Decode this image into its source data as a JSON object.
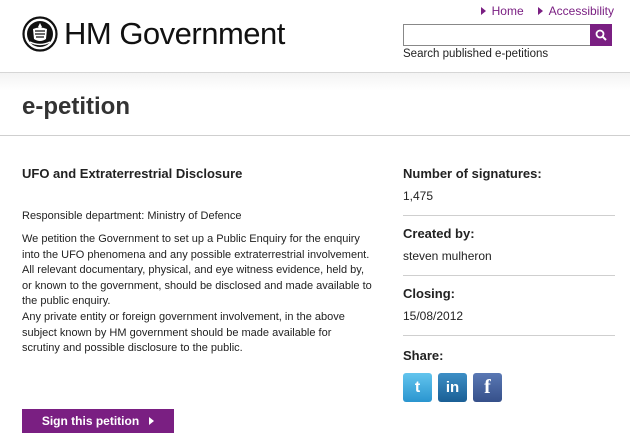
{
  "header": {
    "logo_text": "HM Government",
    "links": [
      {
        "label": "Home"
      },
      {
        "label": "Accessibility"
      }
    ],
    "search": {
      "placeholder": "",
      "value": "",
      "caption": "Search published e-petitions"
    }
  },
  "page": {
    "title": "e-petition"
  },
  "petition": {
    "title": "UFO and Extraterrestrial Disclosure",
    "department": "Responsible department: Ministry of Defence",
    "paragraph1": "We petition the Government to set up a Public Enquiry for the enquiry into the UFO phenomena and any possible extraterrestrial involvement. All relevant documentary, physical, and eye witness evidence, held by, or known to the government, should be disclosed and made available to the public enquiry.",
    "paragraph2": "Any private entity or foreign government involvement, in the above subject known by HM government should be made available for scrutiny and possible disclosure to the public.",
    "sign_button": "Sign this petition"
  },
  "sidebar": {
    "signatures_label": "Number of signatures:",
    "signatures_value": "1,475",
    "created_label": "Created by:",
    "created_value": "steven mulheron",
    "closing_label": "Closing:",
    "closing_value": "15/08/2012",
    "share_label": "Share:",
    "share": [
      {
        "icon": "twitter-icon",
        "glyph": "t"
      },
      {
        "icon": "linkedin-icon",
        "glyph": "in"
      },
      {
        "icon": "facebook-icon",
        "glyph": "f"
      }
    ]
  },
  "colors": {
    "accent": "#7a1f82"
  }
}
